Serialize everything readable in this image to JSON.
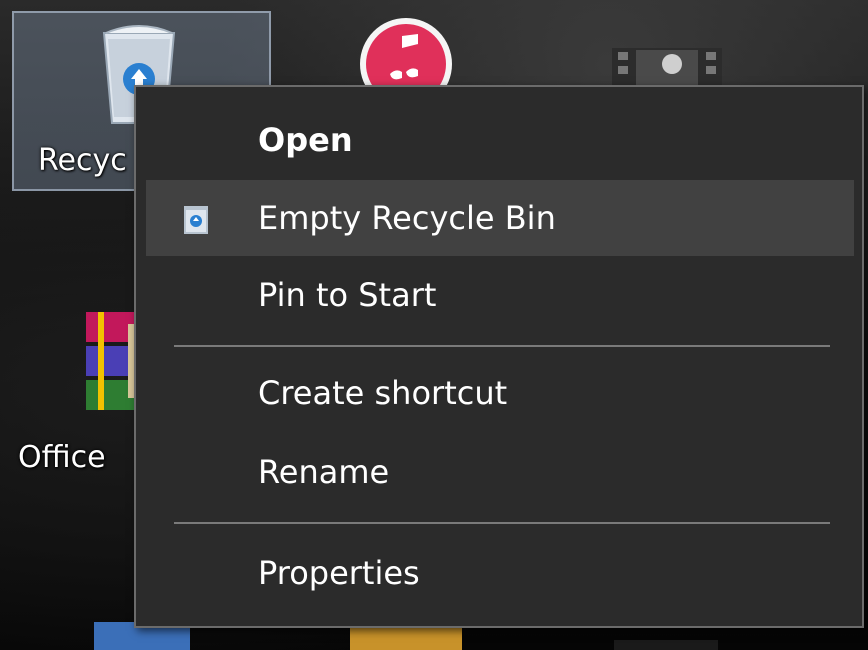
{
  "desktop": {
    "icons": [
      {
        "label": "Recyc",
        "icon": "recycle-bin-icon",
        "selected": true
      },
      {
        "label": "Office",
        "icon": "winrar-icon",
        "selected": false
      }
    ]
  },
  "context_menu": {
    "items": [
      {
        "label": "Open",
        "bold": true,
        "hover": false,
        "icon": null
      },
      {
        "label": "Empty Recycle Bin",
        "bold": false,
        "hover": true,
        "icon": "recycle-bin-small-icon"
      },
      {
        "label": "Pin to Start",
        "bold": false,
        "hover": false,
        "icon": null
      },
      {
        "label": "Create shortcut",
        "bold": false,
        "hover": false,
        "icon": null
      },
      {
        "label": "Rename",
        "bold": false,
        "hover": false,
        "icon": null
      },
      {
        "label": "Properties",
        "bold": false,
        "hover": false,
        "icon": null
      }
    ]
  },
  "colors": {
    "menu_bg": "#2b2b2b",
    "menu_hover": "#414141",
    "menu_text": "#ffffff",
    "separator": "#7a7a7a",
    "selection": "#9aaac8"
  }
}
